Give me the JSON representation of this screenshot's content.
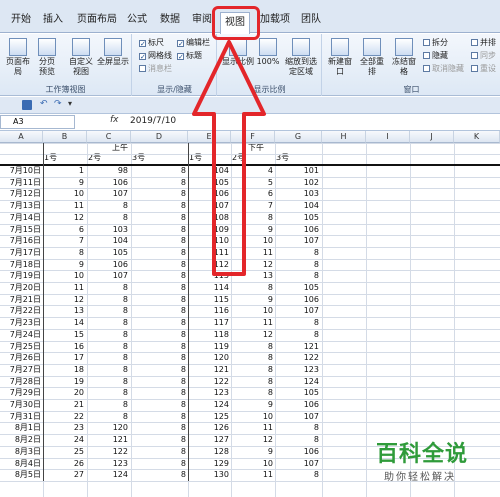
{
  "tabs": [
    {
      "label": "开始"
    },
    {
      "label": "插入"
    },
    {
      "label": "页面布局"
    },
    {
      "label": "公式"
    },
    {
      "label": "数据"
    },
    {
      "label": "审阅"
    },
    {
      "label": "视图",
      "active": true
    },
    {
      "label": "加载项"
    },
    {
      "label": "团队"
    }
  ],
  "ribbon": {
    "workbook_views": {
      "label": "工作簿视图",
      "buttons": [
        "页面布局",
        "分页预览",
        "自定义视图",
        "全屏显示"
      ]
    },
    "show_hide": {
      "label": "显示/隐藏",
      "items": [
        {
          "label": "标尺",
          "checked": true
        },
        {
          "label": "编辑栏",
          "checked": true
        },
        {
          "label": "网格线",
          "checked": true
        },
        {
          "label": "标题",
          "checked": true
        },
        {
          "label": "消息栏",
          "checked": false
        }
      ]
    },
    "zoom": {
      "label": "显示比例",
      "buttons": [
        "显示比例",
        "100%",
        "缩放到选定区域"
      ]
    },
    "window": {
      "label": "窗口",
      "buttons": [
        "新建窗口",
        "全部重排",
        "冻结窗格"
      ],
      "small": [
        "拆分",
        "隐藏",
        "取消隐藏"
      ],
      "right": [
        "并排",
        "同步",
        "重设"
      ]
    }
  },
  "formula_bar": {
    "name_box": "A3",
    "fx": "fx",
    "value": "2019/7/10"
  },
  "columns": [
    "A",
    "B",
    "C",
    "D",
    "E",
    "F",
    "G",
    "H",
    "I",
    "J",
    "K"
  ],
  "header_row1": {
    "am": "上午",
    "pm": "下午"
  },
  "header_row2": [
    "1号",
    "2号",
    "3号",
    "1号",
    "2号",
    "3号"
  ],
  "rows": [
    [
      "7月10日",
      "1",
      "98",
      "8",
      "104",
      "4",
      "101"
    ],
    [
      "7月11日",
      "9",
      "106",
      "8",
      "105",
      "5",
      "102"
    ],
    [
      "7月12日",
      "10",
      "107",
      "8",
      "106",
      "6",
      "103"
    ],
    [
      "7月13日",
      "11",
      "8",
      "8",
      "107",
      "7",
      "104"
    ],
    [
      "7月14日",
      "12",
      "8",
      "8",
      "108",
      "8",
      "105"
    ],
    [
      "7月15日",
      "6",
      "103",
      "8",
      "109",
      "9",
      "106"
    ],
    [
      "7月16日",
      "7",
      "104",
      "8",
      "110",
      "10",
      "107"
    ],
    [
      "7月17日",
      "8",
      "105",
      "8",
      "111",
      "11",
      "8"
    ],
    [
      "7月18日",
      "9",
      "106",
      "8",
      "112",
      "12",
      "8"
    ],
    [
      "7月19日",
      "10",
      "107",
      "8",
      "113",
      "13",
      "8"
    ],
    [
      "7月20日",
      "11",
      "8",
      "8",
      "114",
      "8",
      "105"
    ],
    [
      "7月21日",
      "12",
      "8",
      "8",
      "115",
      "9",
      "106"
    ],
    [
      "7月22日",
      "13",
      "8",
      "8",
      "116",
      "10",
      "107"
    ],
    [
      "7月23日",
      "14",
      "8",
      "8",
      "117",
      "11",
      "8"
    ],
    [
      "7月24日",
      "15",
      "8",
      "8",
      "118",
      "12",
      "8"
    ],
    [
      "7月25日",
      "16",
      "8",
      "8",
      "119",
      "8",
      "121"
    ],
    [
      "7月26日",
      "17",
      "8",
      "8",
      "120",
      "8",
      "122"
    ],
    [
      "7月27日",
      "18",
      "8",
      "8",
      "121",
      "8",
      "123"
    ],
    [
      "7月28日",
      "19",
      "8",
      "8",
      "122",
      "8",
      "124"
    ],
    [
      "7月29日",
      "20",
      "8",
      "8",
      "123",
      "8",
      "105"
    ],
    [
      "7月30日",
      "21",
      "8",
      "8",
      "124",
      "9",
      "106"
    ],
    [
      "7月31日",
      "22",
      "8",
      "8",
      "125",
      "10",
      "107"
    ],
    [
      "8月1日",
      "23",
      "120",
      "8",
      "126",
      "11",
      "8"
    ],
    [
      "8月2日",
      "24",
      "121",
      "8",
      "127",
      "12",
      "8"
    ],
    [
      "8月3日",
      "25",
      "122",
      "8",
      "128",
      "9",
      "106"
    ],
    [
      "8月4日",
      "26",
      "123",
      "8",
      "129",
      "10",
      "107"
    ],
    [
      "8月5日",
      "27",
      "124",
      "8",
      "130",
      "11",
      "8"
    ]
  ],
  "watermark": {
    "title": "百科全说",
    "subtitle": "助你轻松解决"
  },
  "colors": {
    "highlight": "#e3262a",
    "watermark": "#2f9b3a"
  }
}
